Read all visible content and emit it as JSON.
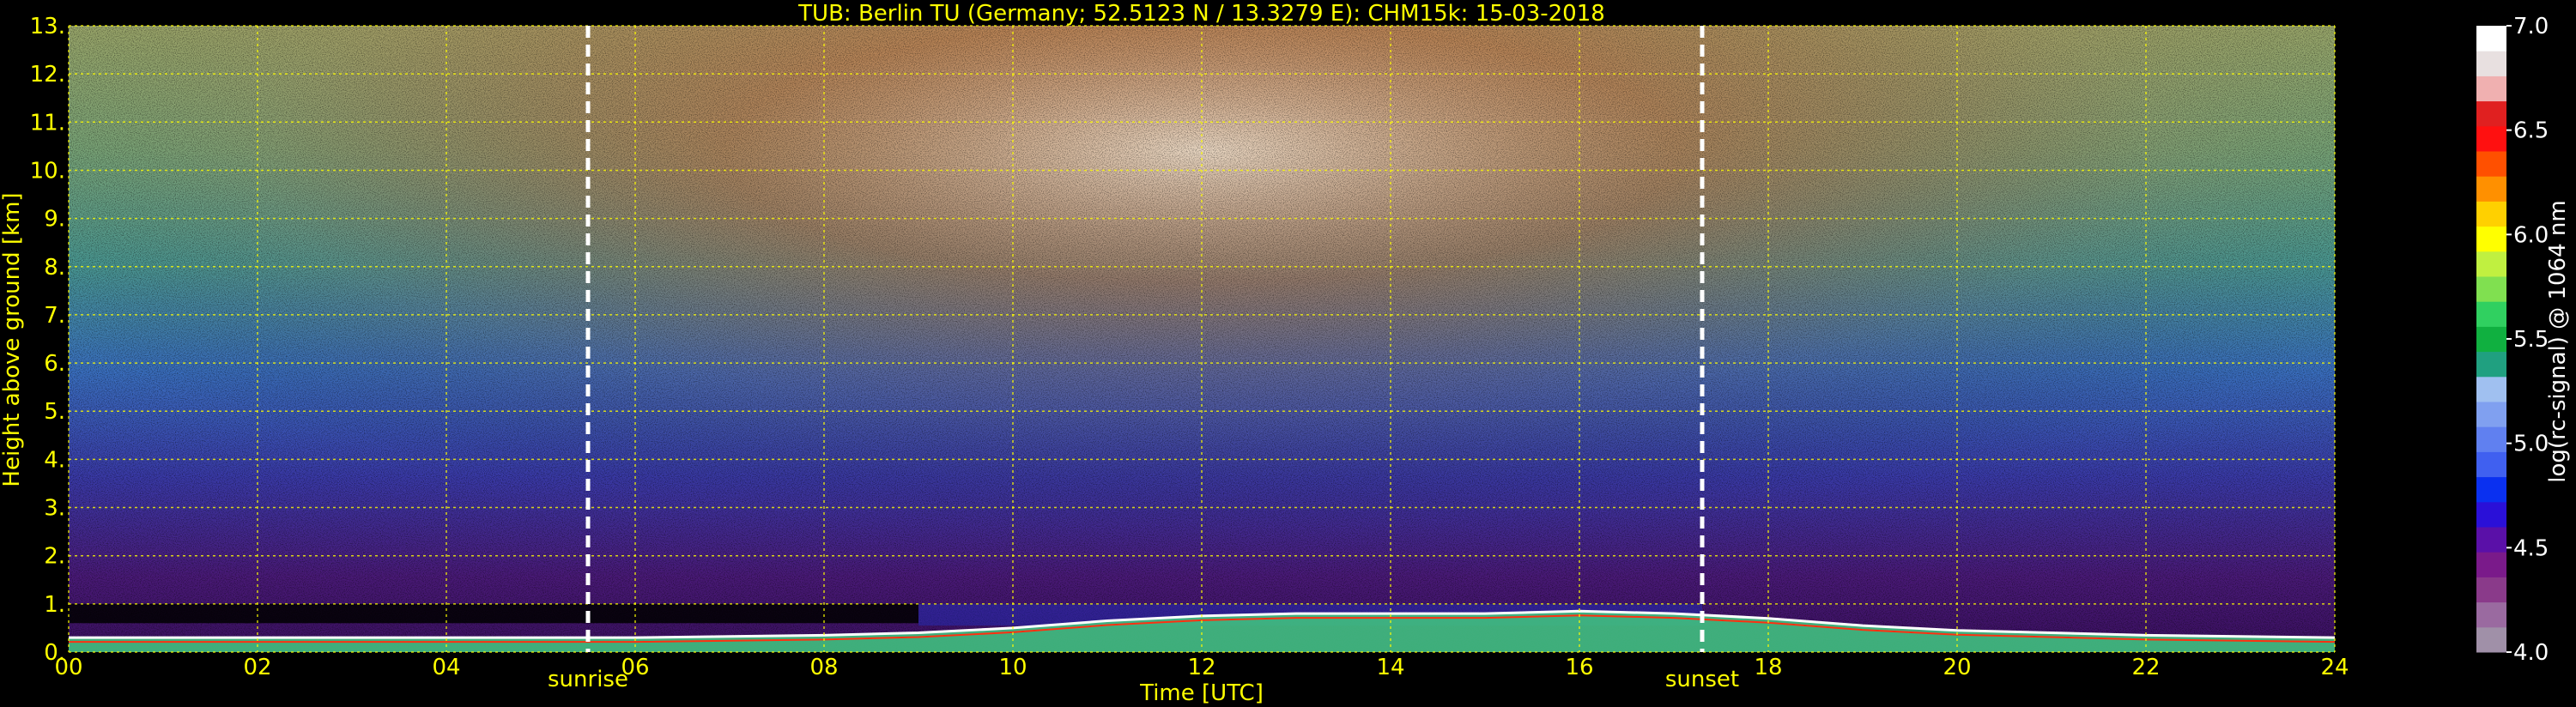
{
  "chart_data": {
    "type": "heatmap",
    "title": "TUB: Berlin TU (Germany; 52.5123 N / 13.3279 E):    CHM15k: 15-03-2018",
    "xlabel": "Time [UTC]",
    "ylabel": "Height above ground [km]",
    "xlim": [
      0,
      24
    ],
    "ylim": [
      0,
      13
    ],
    "x_ticks": [
      "00",
      "02",
      "04",
      "06",
      "08",
      "10",
      "12",
      "14",
      "16",
      "18",
      "20",
      "22",
      "24"
    ],
    "y_ticks": [
      "0.",
      "1.",
      "2.",
      "3.",
      "4.",
      "5.",
      "6.",
      "7.",
      "8.",
      "9.",
      "10.",
      "11.",
      "12.",
      "13."
    ],
    "grid": true,
    "annotations": [
      {
        "label": "sunrise",
        "x": 5.5
      },
      {
        "label": "sunset",
        "x": 17.3
      }
    ],
    "colorbar": {
      "label": "log(rc-signal) @ 1064 nm",
      "range": [
        4.0,
        7.0
      ],
      "ticks": [
        "4.0",
        "4.5",
        "5.0",
        "5.5",
        "6.0",
        "6.5",
        "7.0"
      ]
    },
    "boundary_layer_top_km": {
      "x": [
        0,
        2,
        4,
        6,
        8,
        9,
        10,
        11,
        12,
        13,
        14,
        15,
        16,
        17,
        18,
        19,
        20,
        22,
        24
      ],
      "y": [
        0.3,
        0.3,
        0.3,
        0.3,
        0.35,
        0.4,
        0.5,
        0.65,
        0.75,
        0.8,
        0.8,
        0.8,
        0.85,
        0.8,
        0.7,
        0.55,
        0.45,
        0.35,
        0.3
      ]
    },
    "low_cloud_layer_km": {
      "x_range": [
        0,
        9
      ],
      "height_range": [
        0.6,
        1.0
      ]
    }
  },
  "colors": {
    "text": "#ffff00",
    "grid": "#ffff00",
    "colorbar_text": "#ffffff",
    "colormap": [
      "#a090a8",
      "#9a6aa0",
      "#8a3a8a",
      "#7a1a8a",
      "#5a10a8",
      "#2a10d8",
      "#0a30f0",
      "#4060f0",
      "#6080f0",
      "#80a0f0",
      "#a0c0f0",
      "#20a080",
      "#10b040",
      "#30d060",
      "#80e050",
      "#c0f040",
      "#ffff00",
      "#ffd000",
      "#ff9000",
      "#ff5000",
      "#ff1010",
      "#e02020",
      "#f0b0b0",
      "#e8e0e0",
      "#ffffff"
    ]
  }
}
